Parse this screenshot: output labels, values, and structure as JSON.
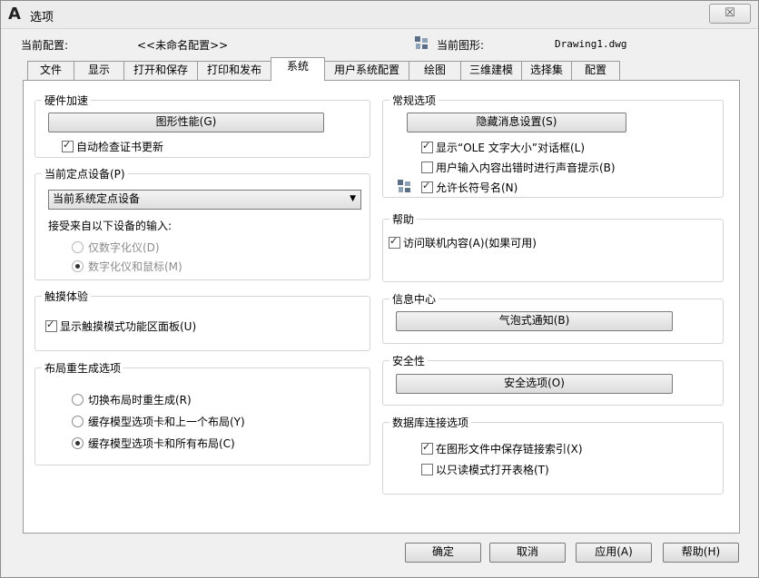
{
  "window": {
    "title": "选项",
    "close_label": "☒"
  },
  "profile": {
    "label": "当前配置:",
    "value": "<<未命名配置>>"
  },
  "drawing": {
    "label": "当前图形:",
    "value": "Drawing1.dwg"
  },
  "tabs": [
    {
      "label": "文件"
    },
    {
      "label": "显示"
    },
    {
      "label": "打开和保存"
    },
    {
      "label": "打印和发布"
    },
    {
      "label": "系统",
      "active": true
    },
    {
      "label": "用户系统配置"
    },
    {
      "label": "绘图"
    },
    {
      "label": "三维建模"
    },
    {
      "label": "选择集"
    },
    {
      "label": "配置"
    }
  ],
  "hardware": {
    "title": "硬件加速",
    "button": "图形性能(G)",
    "check_cert": {
      "label": "自动检查证书更新",
      "checked": true
    }
  },
  "pointing": {
    "title": "当前定点设备(P)",
    "select_value": "当前系统定点设备",
    "accept_label": "接受来自以下设备的输入:",
    "radio_digitizer": {
      "label": "仅数字化仪(D)",
      "checked": false
    },
    "radio_both": {
      "label": "数字化仪和鼠标(M)",
      "checked": true
    }
  },
  "touch": {
    "title": "触摸体验",
    "check_ribbon": {
      "label": "显示触摸模式功能区面板(U)",
      "checked": true
    }
  },
  "layout_regen": {
    "title": "布局重生成选项",
    "radio1": {
      "label": "切换布局时重生成(R)",
      "checked": false
    },
    "radio2": {
      "label": "缓存模型选项卡和上一个布局(Y)",
      "checked": false
    },
    "radio3": {
      "label": "缓存模型选项卡和所有布局(C)",
      "checked": true
    }
  },
  "general": {
    "title": "常规选项",
    "button": "隐藏消息设置(S)",
    "check_ole": {
      "label": "显示“OLE 文字大小”对话框(L)",
      "checked": true
    },
    "check_beep": {
      "label": "用户输入内容出错时进行声音提示(B)",
      "checked": false
    },
    "check_longnames": {
      "label": "允许长符号名(N)",
      "checked": true
    }
  },
  "help": {
    "title": "帮助",
    "check_online": {
      "label": "访问联机内容(A)(如果可用)",
      "checked": true
    }
  },
  "infocenter": {
    "title": "信息中心",
    "button": "气泡式通知(B)"
  },
  "security": {
    "title": "安全性",
    "button": "安全选项(O)"
  },
  "dbconnect": {
    "title": "数据库连接选项",
    "check_index": {
      "label": "在图形文件中保存链接索引(X)",
      "checked": true
    },
    "check_readonly": {
      "label": "以只读模式打开表格(T)",
      "checked": false
    }
  },
  "footer": {
    "ok": "确定",
    "cancel": "取消",
    "apply": "应用(A)",
    "help": "帮助(H)"
  }
}
